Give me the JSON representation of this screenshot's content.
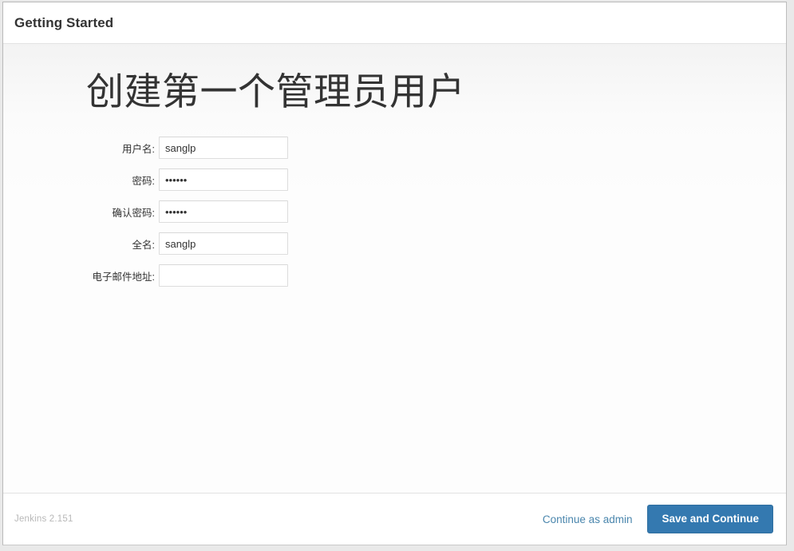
{
  "window": {
    "header_title": "Getting Started"
  },
  "setup": {
    "heading": "创建第一个管理员用户",
    "fields": [
      {
        "name": "username",
        "label": "用户名:",
        "type": "text",
        "value": "sanglp",
        "placeholder": ""
      },
      {
        "name": "password",
        "label": "密码:",
        "type": "password",
        "value": "••••••",
        "placeholder": ""
      },
      {
        "name": "confirm-password",
        "label": "确认密码:",
        "type": "password",
        "value": "••••••",
        "placeholder": ""
      },
      {
        "name": "fullname",
        "label": "全名:",
        "type": "text",
        "value": "sanglp",
        "placeholder": ""
      },
      {
        "name": "email",
        "label": "电子邮件地址:",
        "type": "text",
        "value": "",
        "placeholder": ""
      }
    ]
  },
  "footer": {
    "version": "Jenkins 2.151",
    "continue_as_admin_label": "Continue as admin",
    "save_and_continue_label": "Save and Continue"
  },
  "colors": {
    "primary_button": "#3479b0",
    "link": "#4a86ad",
    "heading_text": "#333333",
    "version_text": "#b8b8b8",
    "input_border": "#dddddd",
    "window_border": "#b9b9b9"
  }
}
